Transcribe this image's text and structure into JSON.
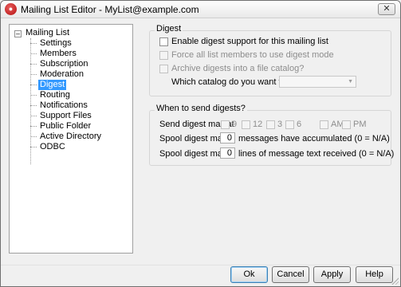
{
  "window": {
    "title": "Mailing List Editor - MyList@example.com",
    "close_label": "✕"
  },
  "tree": {
    "root_label": "Mailing List",
    "expander": "–",
    "items": [
      {
        "label": "Settings"
      },
      {
        "label": "Members"
      },
      {
        "label": "Subscription"
      },
      {
        "label": "Moderation"
      },
      {
        "label": "Digest",
        "selected": true
      },
      {
        "label": "Routing"
      },
      {
        "label": "Notifications"
      },
      {
        "label": "Support Files"
      },
      {
        "label": "Public Folder"
      },
      {
        "label": "Active Directory"
      },
      {
        "label": "ODBC"
      }
    ]
  },
  "digest": {
    "group_title": "Digest",
    "enable_label": "Enable digest support for this mailing list",
    "enable_checked": false,
    "force_label": "Force all list members to use digest mode",
    "archive_label": "Archive digests into a file catalog?",
    "catalog_question": "Which catalog do you want to use?",
    "catalog_value": ""
  },
  "when": {
    "group_title": "When to send digests?",
    "send_at_label": "Send digest mail at",
    "hours": [
      "9",
      "12",
      "3",
      "6"
    ],
    "am_label": "AM",
    "pm_label": "PM",
    "spool1_label": "Spool digest mail if",
    "spool1_value": "0",
    "spool1_suffix": "messages have accumulated (0 = N/A)",
    "spool2_label": "Spool digest mail if",
    "spool2_value": "0",
    "spool2_suffix": "lines of message text received (0 = N/A)"
  },
  "buttons": {
    "ok": "Ok",
    "cancel": "Cancel",
    "apply": "Apply",
    "help": "Help"
  }
}
